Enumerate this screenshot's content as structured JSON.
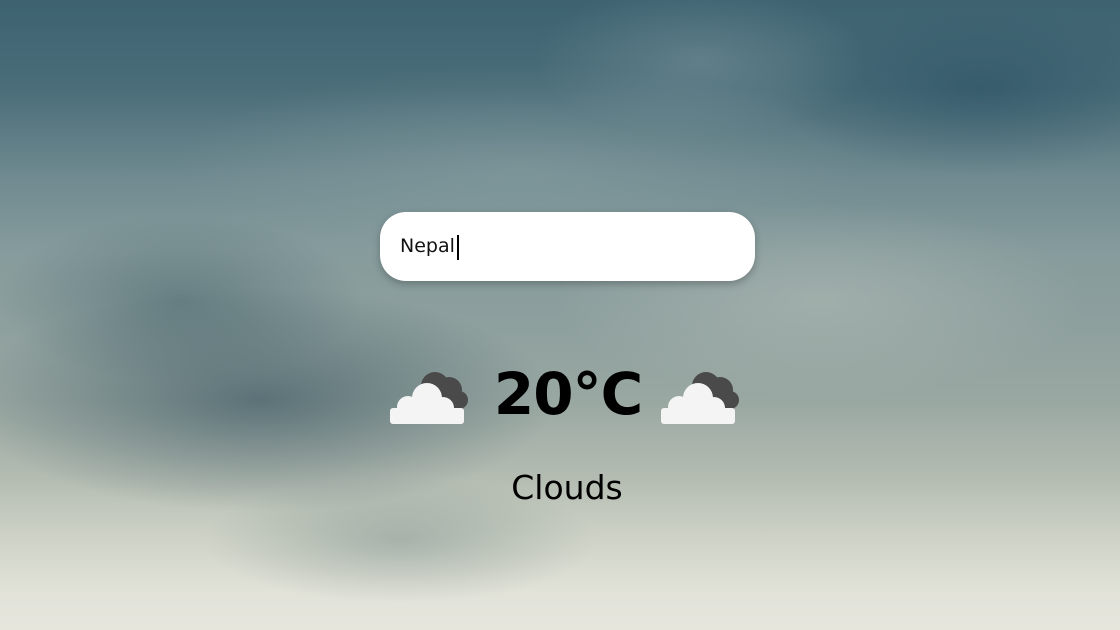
{
  "search": {
    "value": "Nepal",
    "placeholder": ""
  },
  "weather": {
    "temperature": "20°C",
    "condition": "Clouds",
    "icon": "cloud-icon"
  },
  "colors": {
    "text": "#000000",
    "search_bg": "#ffffff"
  }
}
